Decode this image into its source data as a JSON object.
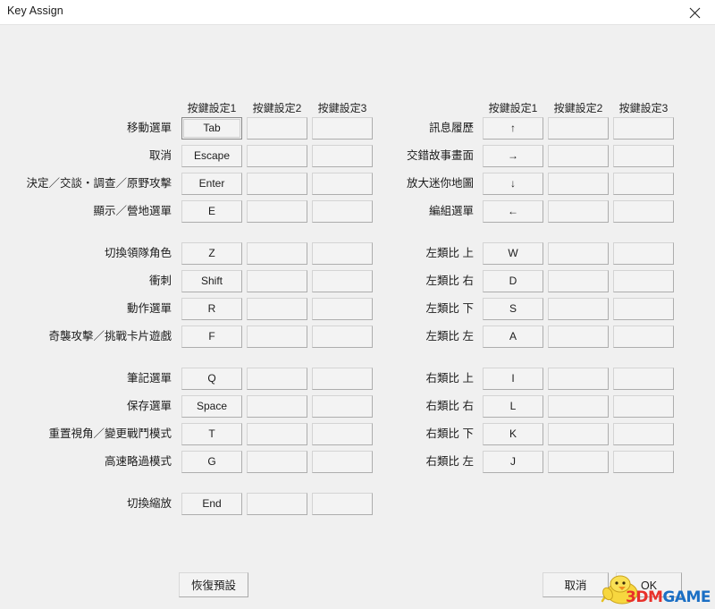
{
  "window": {
    "title": "Key Assign",
    "close_icon": "close-icon"
  },
  "columns": [
    "按鍵設定1",
    "按鍵設定2",
    "按鍵設定3"
  ],
  "left_groups": [
    {
      "rows": [
        {
          "label": "移動選單",
          "keys": [
            "Tab",
            "",
            ""
          ],
          "focused": true
        },
        {
          "label": "取消",
          "keys": [
            "Escape",
            "",
            ""
          ],
          "focused": false
        },
        {
          "label": "決定／交談・調查／原野攻擊",
          "keys": [
            "Enter",
            "",
            ""
          ],
          "focused": false
        },
        {
          "label": "顯示／營地選單",
          "keys": [
            "E",
            "",
            ""
          ],
          "focused": false
        }
      ]
    },
    {
      "rows": [
        {
          "label": "切換領隊角色",
          "keys": [
            "Z",
            "",
            ""
          ],
          "focused": false
        },
        {
          "label": "衝刺",
          "keys": [
            "Shift",
            "",
            ""
          ],
          "focused": false
        },
        {
          "label": "動作選單",
          "keys": [
            "R",
            "",
            ""
          ],
          "focused": false
        },
        {
          "label": "奇襲攻擊／挑戰卡片遊戲",
          "keys": [
            "F",
            "",
            ""
          ],
          "focused": false
        }
      ]
    },
    {
      "rows": [
        {
          "label": "筆記選單",
          "keys": [
            "Q",
            "",
            ""
          ],
          "focused": false
        },
        {
          "label": "保存選單",
          "keys": [
            "Space",
            "",
            ""
          ],
          "focused": false
        },
        {
          "label": "重置視角／變更戰鬥模式",
          "keys": [
            "T",
            "",
            ""
          ],
          "focused": false
        },
        {
          "label": "高速略過模式",
          "keys": [
            "G",
            "",
            ""
          ],
          "focused": false
        }
      ]
    },
    {
      "rows": [
        {
          "label": "切換縮放",
          "keys": [
            "End",
            "",
            ""
          ],
          "focused": false
        }
      ]
    }
  ],
  "right_groups": [
    {
      "rows": [
        {
          "label": "訊息履歷",
          "keys": [
            "↑",
            "",
            ""
          ],
          "focused": false
        },
        {
          "label": "交錯故事畫面",
          "keys": [
            "→",
            "",
            ""
          ],
          "focused": false
        },
        {
          "label": "放大迷你地圖",
          "keys": [
            "↓",
            "",
            ""
          ],
          "focused": false
        },
        {
          "label": "編組選單",
          "keys": [
            "←",
            "",
            ""
          ],
          "focused": false
        }
      ]
    },
    {
      "rows": [
        {
          "label": "左類比 上",
          "keys": [
            "W",
            "",
            ""
          ],
          "focused": false
        },
        {
          "label": "左類比 右",
          "keys": [
            "D",
            "",
            ""
          ],
          "focused": false
        },
        {
          "label": "左類比 下",
          "keys": [
            "S",
            "",
            ""
          ],
          "focused": false
        },
        {
          "label": "左類比 左",
          "keys": [
            "A",
            "",
            ""
          ],
          "focused": false
        }
      ]
    },
    {
      "rows": [
        {
          "label": "右類比 上",
          "keys": [
            "I",
            "",
            ""
          ],
          "focused": false
        },
        {
          "label": "右類比 右",
          "keys": [
            "L",
            "",
            ""
          ],
          "focused": false
        },
        {
          "label": "右類比 下",
          "keys": [
            "K",
            "",
            ""
          ],
          "focused": false
        },
        {
          "label": "右類比 左",
          "keys": [
            "J",
            "",
            ""
          ],
          "focused": false
        }
      ]
    }
  ],
  "footer": {
    "restore_label": "恢復預設",
    "cancel_label": "取消",
    "ok_label": "OK"
  },
  "watermark": {
    "text_part1": "3DM",
    "text_part2": "GAME",
    "mascot_icon": "chick-mascot-icon",
    "color_part1": "#e8312a",
    "color_part2": "#1b6fc4"
  }
}
